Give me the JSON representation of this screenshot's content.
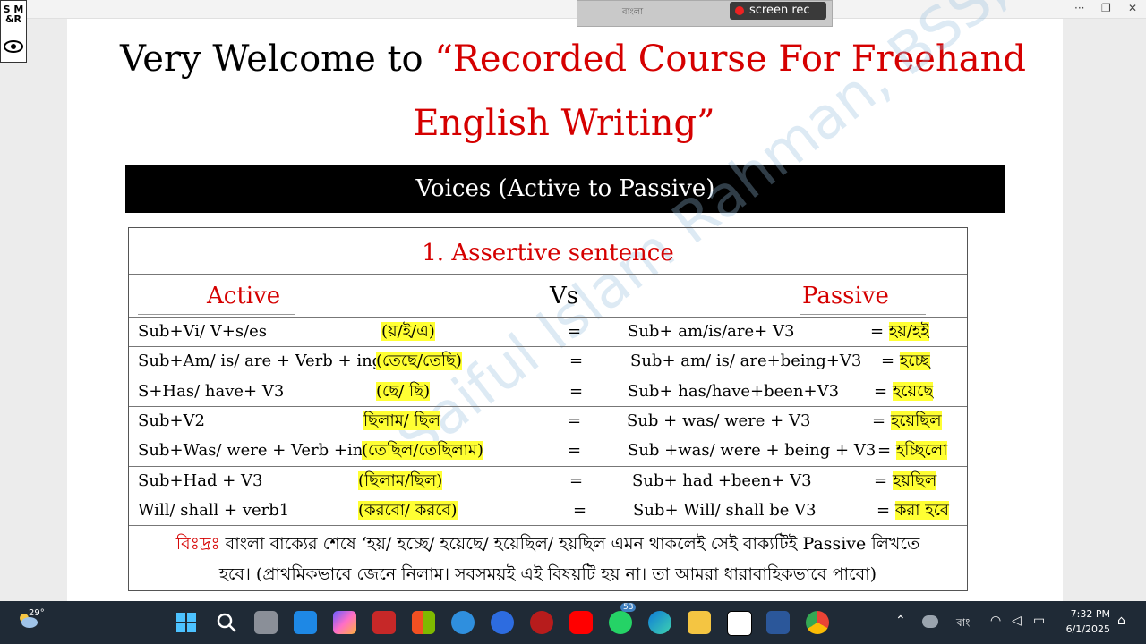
{
  "title": {
    "line1_black": "Very Welcome to ",
    "line1_red": "“Recorded Course For Freehand",
    "line2_red": "English Writing”"
  },
  "banner": "Voices (Active to Passive)",
  "section_title": "1. Assertive sentence",
  "headers": {
    "active": "Active",
    "vs": "Vs",
    "passive": "Passive"
  },
  "rows": [
    {
      "active": "Sub+Vi/ V+s/es",
      "active_bn": "(য়/ই/এ)",
      "eq": "=",
      "passive": "Sub+ am/is/are+ V3",
      "passive_bn": "= হয়/হই"
    },
    {
      "active": "Sub+Am/ is/ are + Verb + ing",
      "active_bn": "(তেছে/তেছি)",
      "eq": "=",
      "passive": "Sub+ am/ is/ are+being+V3",
      "passive_bn": "= হচ্ছে"
    },
    {
      "active": "S+Has/ have+ V3",
      "active_bn": "(ছে/ ছি)",
      "eq": "=",
      "passive": "Sub+ has/have+been+V3",
      "passive_bn": "= হয়েছে"
    },
    {
      "active": "Sub+V2",
      "active_bn": "ছিলাম/ ছিল",
      "eq": "=",
      "passive": "Sub + was/ were + V3",
      "passive_bn": "= হয়েছিল"
    },
    {
      "active": "Sub+Was/ were + Verb +ing",
      "active_bn": "(তেছিল/তেছিলাম)",
      "eq": "=",
      "passive": "Sub +was/ were + being + V3",
      "passive_bn": "= হচ্ছিলো"
    },
    {
      "active": "Sub+Had + V3",
      "active_bn": "(ছিলাম/ছিল)",
      "eq": "=",
      "passive": "Sub+ had +been+ V3",
      "passive_bn": "= হয়ছিল"
    },
    {
      "active": "Will/ shall + verb1",
      "active_bn": "(করবো/ করবে)",
      "eq": "=",
      "passive": "Sub+ Will/ shall be V3",
      "passive_bn": "= করা হবে"
    }
  ],
  "note": {
    "label": "বিঃদ্রঃ",
    "line1": " বাংলা বাক্যের শেষে ‘হয়/ হচ্ছে/ হয়েছে/ হয়েছিল/ হয়ছিল এমন থাকলেই সেই বাক্যটিই Passive লিখতে",
    "line2": "হবে। (প্রাথমিকভাবে জেনে নিলাম। সবসময়ই এই বিষয়টি হয় না। তা আমরা ধারাবাহিকভাবে পাবো)"
  },
  "watermark": "Saiful Islam Rahman, BSS, MSS, IR, DU",
  "logo": {
    "line1": "S M",
    "line2": "&R"
  },
  "recorder": {
    "label": "screen rec",
    "lang": "বাংলা"
  },
  "taskbar": {
    "weather_temp": "29°",
    "badge_count": "53",
    "language": "বাং",
    "time": "7:32 PM",
    "date": "6/1/2025"
  },
  "colors": {
    "accent_red": "#d50000",
    "highlight": "#ffff33",
    "banner_bg": "#000000",
    "taskbar_bg": "#1f2a36"
  }
}
